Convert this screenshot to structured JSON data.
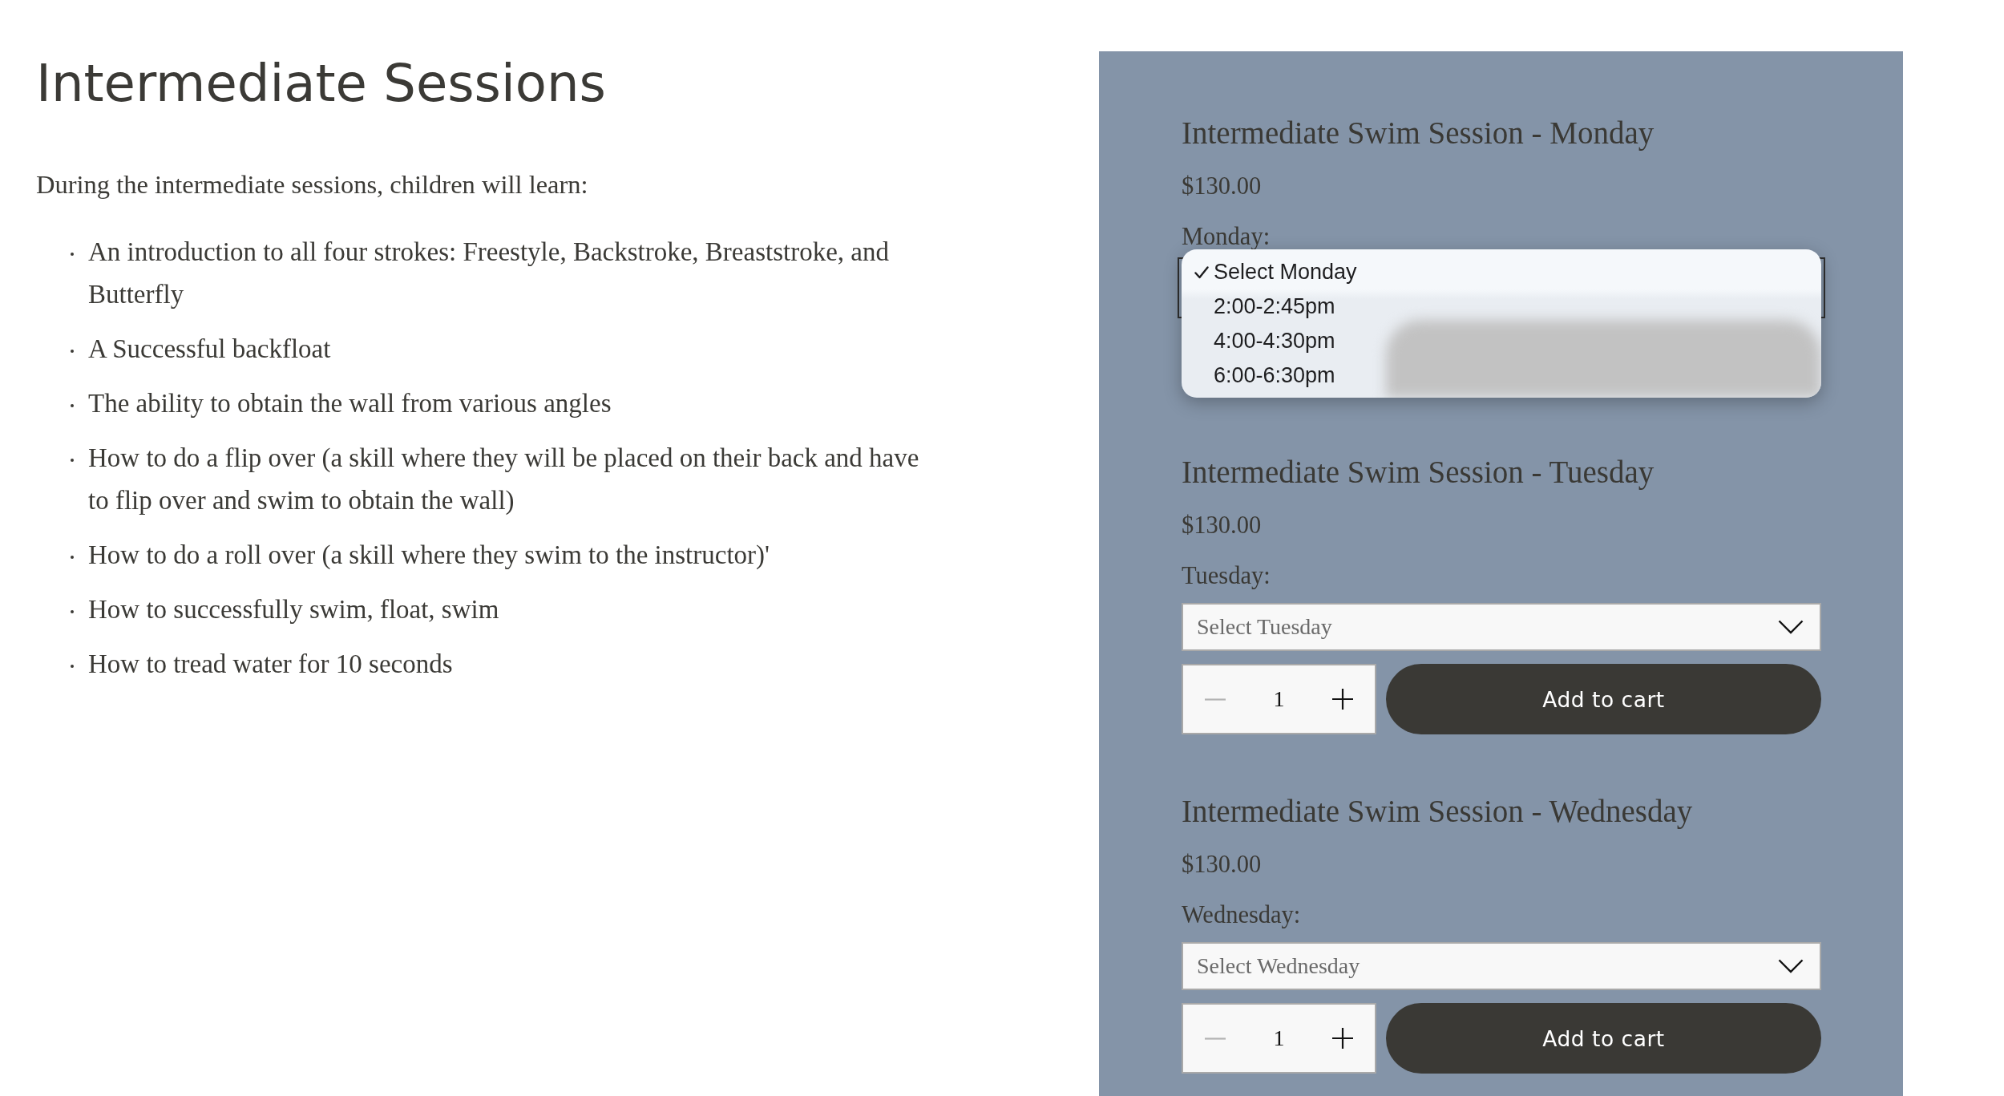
{
  "heading": "Intermediate Sessions",
  "intro": "During the intermediate sessions, children will learn:",
  "skills": [
    "An introduction to all four strokes: Freestyle, Backstroke, Breaststroke, and Butterfly",
    "A Successful backfloat",
    "The ability to obtain the wall from various angles",
    "How to do a flip over (a skill where they will be placed on their back and have to flip over and swim to obtain the wall)",
    "How to do a roll over (a skill where they swim to the instructor)'",
    "How to successfully swim, float, swim",
    "How to tread water for 10 seconds"
  ],
  "products": [
    {
      "title": "Intermediate Swim Session - Monday",
      "price": "$130.00",
      "label": "Monday:",
      "select": {
        "open": true,
        "options": [
          {
            "label": "Select Monday",
            "selected": true
          },
          {
            "label": "2:00-2:45pm",
            "selected": false
          },
          {
            "label": "4:00-4:30pm",
            "selected": false
          },
          {
            "label": "6:00-6:30pm",
            "selected": false
          }
        ]
      }
    },
    {
      "title": "Intermediate Swim Session - Tuesday",
      "price": "$130.00",
      "label": "Tuesday:",
      "select": {
        "open": false,
        "value": "Select Tuesday"
      },
      "quantity": {
        "value": "1",
        "decrease_disabled": true
      },
      "button": "Add to cart"
    },
    {
      "title": "Intermediate Swim Session - Wednesday",
      "price": "$130.00",
      "label": "Wednesday:",
      "select": {
        "open": false,
        "value": "Select Wednesday"
      },
      "quantity": {
        "value": "1",
        "decrease_disabled": true
      },
      "button": "Add to cart"
    }
  ]
}
